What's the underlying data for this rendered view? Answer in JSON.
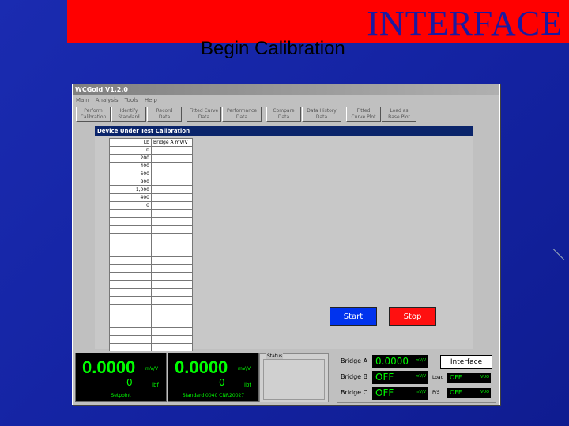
{
  "slide": {
    "title": "INTERFACE",
    "subtitle": "Begin Calibration"
  },
  "window": {
    "title": "WCGold  V1.2.0",
    "menu": [
      "Main",
      "Analysis",
      "Tools",
      "Help"
    ],
    "toolbar": [
      "Perform\nCalibration",
      "Identify\nStandard",
      "Record\nData",
      "Fitted Curve\nData",
      "Performance\nData",
      "Compare\nData",
      "Data History\nData",
      "Fitted\nCurve Plot",
      "Load as\nBase Plot"
    ]
  },
  "dut": {
    "header": "Device Under Test  Calibration",
    "col_lb": "Lb",
    "col_bridge": "Bridge A mV/V",
    "rows": [
      "0",
      "200",
      "400",
      "600",
      "800",
      "1,000",
      "400",
      "0",
      "",
      "",
      "",
      "",
      "",
      "",
      "",
      "",
      "",
      "",
      "",
      "",
      "",
      "",
      "",
      "",
      "",
      "",
      "",
      "",
      ""
    ]
  },
  "controls": {
    "start": "Start",
    "stop": "Stop"
  },
  "readouts": [
    {
      "value": "0.0000",
      "unit": "mV/V",
      "zero": "0",
      "zero_unit": "lbf",
      "footer": "Setpoint"
    },
    {
      "value": "0.0000",
      "unit": "mV/V",
      "zero": "0",
      "zero_unit": "lbf",
      "footer": "Standard 0040 CNR20027"
    }
  ],
  "status": {
    "label": "Status"
  },
  "bridges": [
    {
      "label": "Bridge A",
      "value": "0.0000",
      "unit": "mV/V"
    },
    {
      "label": "Bridge B",
      "value": "OFF",
      "unit": "mV/V"
    },
    {
      "label": "Bridge C",
      "value": "OFF",
      "unit": "mV/V"
    }
  ],
  "interface_button": "Interface",
  "small_readouts": [
    {
      "label": "Load",
      "value": "OFF",
      "unit": "VUO"
    },
    {
      "label": "P/S",
      "value": "OFF",
      "unit": "VUO"
    }
  ],
  "colors": {
    "banner": "#ff0000",
    "background": "#1322a0",
    "start": "#0033ee",
    "stop": "#ff1010",
    "lcd": "#00ff00"
  }
}
